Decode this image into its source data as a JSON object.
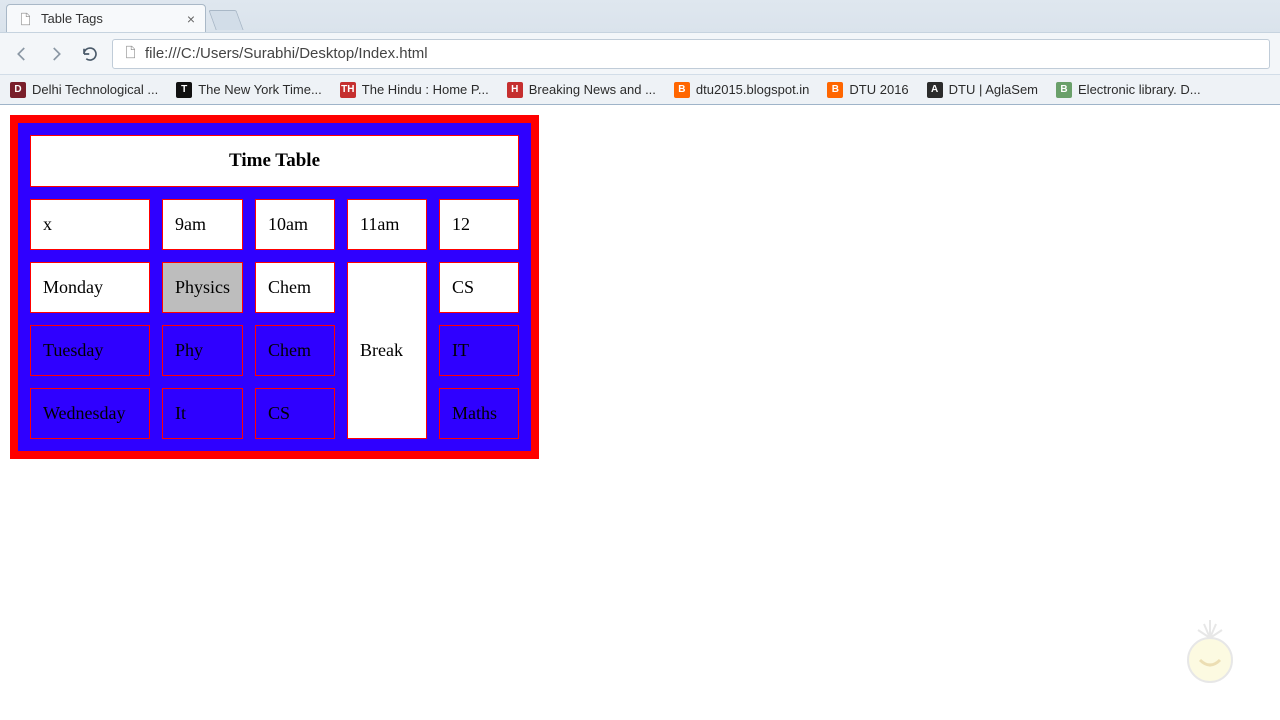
{
  "browser": {
    "tab_title": "Table Tags",
    "url": "file:///C:/Users/Surabhi/Desktop/Index.html",
    "bookmarks": [
      {
        "label": "Delhi Technological ...",
        "icon_bg": "#7a1f2b",
        "icon_text": "D"
      },
      {
        "label": "The New York Time...",
        "icon_bg": "#111",
        "icon_text": "T"
      },
      {
        "label": "The Hindu : Home P...",
        "icon_bg": "#c52f2f",
        "icon_text": "TH"
      },
      {
        "label": "Breaking News and ...",
        "icon_bg": "#c52f2f",
        "icon_text": "H"
      },
      {
        "label": "dtu2015.blogspot.in",
        "icon_bg": "#ff6600",
        "icon_text": "B"
      },
      {
        "label": "DTU 2016",
        "icon_bg": "#ff6600",
        "icon_text": "B"
      },
      {
        "label": "DTU | AglaSem",
        "icon_bg": "#2b2b2b",
        "icon_text": "A"
      },
      {
        "label": "Electronic library. D...",
        "icon_bg": "#6aa06a",
        "icon_text": "B"
      }
    ]
  },
  "table": {
    "caption": "Time Table",
    "header": [
      "x",
      "9am",
      "10am",
      "11am",
      "12"
    ],
    "rows": [
      {
        "day": "Monday",
        "c1": "Physics",
        "c2": "Chem",
        "c3_rowspanned": true,
        "c4": "CS",
        "c1_selected": true
      },
      {
        "day": "Tuesday",
        "c1": "Phy",
        "c2": "Chem",
        "c4": "IT",
        "hidden": true
      },
      {
        "day": "Wednesday",
        "c1": "It",
        "c2": "CS",
        "c4": "Maths",
        "hidden": true
      }
    ],
    "break_label": "Break"
  }
}
